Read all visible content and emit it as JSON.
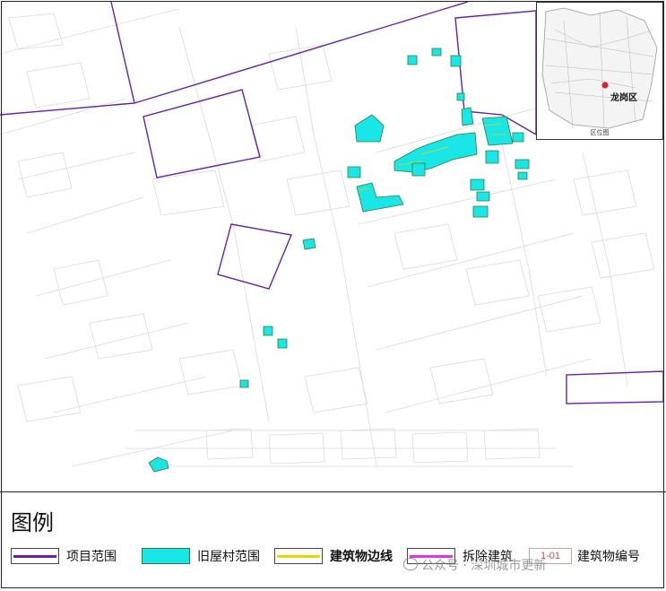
{
  "map": {
    "colors": {
      "project_boundary": "#6a1fa8",
      "old_village_fill": "#19e6e6",
      "old_village_stroke": "#2e7d32",
      "building_line": "#e6d800",
      "demolition_line": "#e632e6",
      "road_network": "#dadada"
    },
    "inset": {
      "district_label": "龙岗区",
      "caption": "区位图",
      "marker_color": "#e02020"
    }
  },
  "legend": {
    "title": "图例",
    "items": [
      {
        "label": "项目范围",
        "icon": "purple-line"
      },
      {
        "label": "旧屋村范围",
        "icon": "cyan-fill-box"
      },
      {
        "label": "建筑物边线",
        "icon": "yellow-line"
      },
      {
        "label": "拆除建筑",
        "icon": "magenta-line"
      },
      {
        "label": "建筑物编号",
        "icon": "number-box",
        "sample": "1-01"
      }
    ]
  },
  "watermark": {
    "text": "公众号 · 深圳城市更新"
  }
}
